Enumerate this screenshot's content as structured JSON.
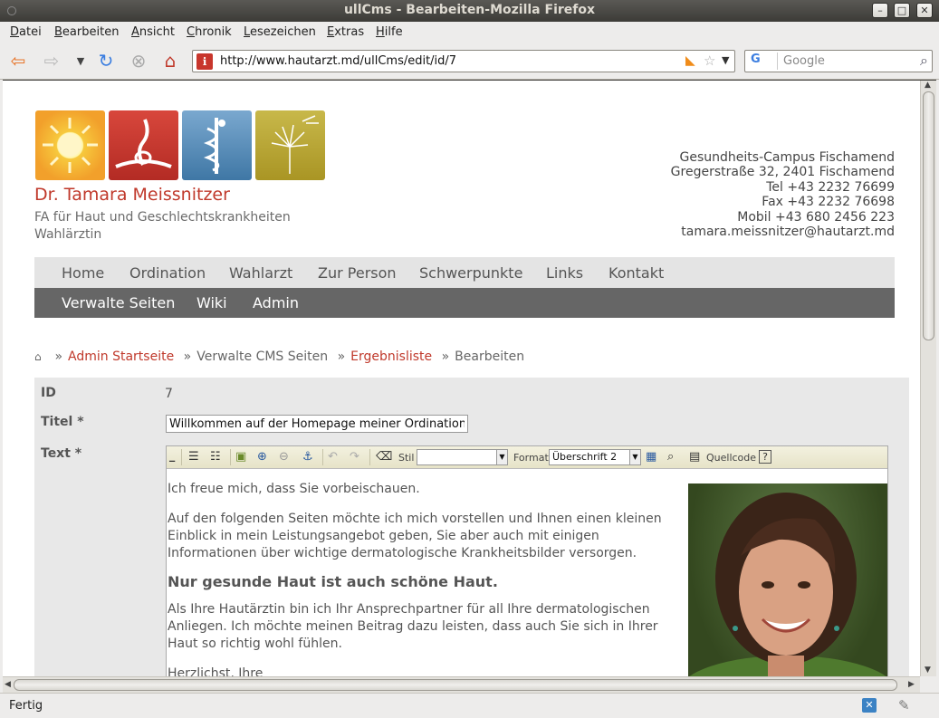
{
  "window": {
    "title": "ullCms - Bearbeiten-Mozilla Firefox",
    "min": "–",
    "max": "□",
    "close": "✕"
  },
  "menu": [
    "Datei",
    "Bearbeiten",
    "Ansicht",
    "Chronik",
    "Lesezeichen",
    "Extras",
    "Hilfe"
  ],
  "toolbar": {
    "url": "http://www.hautarzt.md/ullCms/edit/id/7",
    "search_engine": "G",
    "search_placeholder": "Google"
  },
  "site": {
    "name": "Dr. Tamara Meissnitzer",
    "subtitle1": "FA für Haut und Geschlechtskrankheiten",
    "subtitle2": "Wahlärztin",
    "contact": [
      "Gesundheits-Campus Fischamend",
      "Gregerstraße 32, 2401 Fischamend",
      "Tel +43 2232 76699",
      "Fax +43 2232 76698",
      "Mobil +43 680 2456 223",
      "tamara.meissnitzer@hautarzt.md"
    ]
  },
  "mainnav": [
    "Home",
    "Ordination",
    "Wahlarzt",
    "Zur Person",
    "Schwerpunkte",
    "Links",
    "Kontakt"
  ],
  "adminnav": [
    "Verwalte Seiten",
    "Wiki",
    "Admin"
  ],
  "breadcrumb": {
    "sep": "»",
    "admin_start": "Admin Startseite",
    "manage_cms": "Verwalte CMS Seiten",
    "results": "Ergebnisliste",
    "current": "Bearbeiten"
  },
  "form": {
    "id_label": "ID",
    "id_value": "7",
    "title_label": "Titel *",
    "title_value": "Willkommen auf der Homepage meiner Ordination!",
    "text_label": "Text *"
  },
  "editor": {
    "style_label": "Stil",
    "style_value": "",
    "format_label": "Format",
    "format_value": "Überschrift 2",
    "source_label": "Quellcode",
    "p1": "Ich freue mich, dass Sie vorbeischauen.",
    "p2": "Auf den folgenden Seiten möchte ich mich vorstellen und Ihnen einen kleinen Einblick in mein Leistungsangebot geben, Sie aber auch mit einigen Informationen über wichtige dermatologische Krankheitsbilder versorgen.",
    "h": "Nur gesunde Haut ist auch schöne Haut.",
    "p3": "Als Ihre Hautärztin bin ich Ihr Ansprechpartner für all Ihre dermatologischen Anliegen. Ich möchte meinen Beitrag dazu leisten, dass auch Sie sich in Ihrer Haut so richtig wohl fühlen.",
    "p4": "Herzlichst, Ihre"
  },
  "status": {
    "text": "Fertig"
  }
}
